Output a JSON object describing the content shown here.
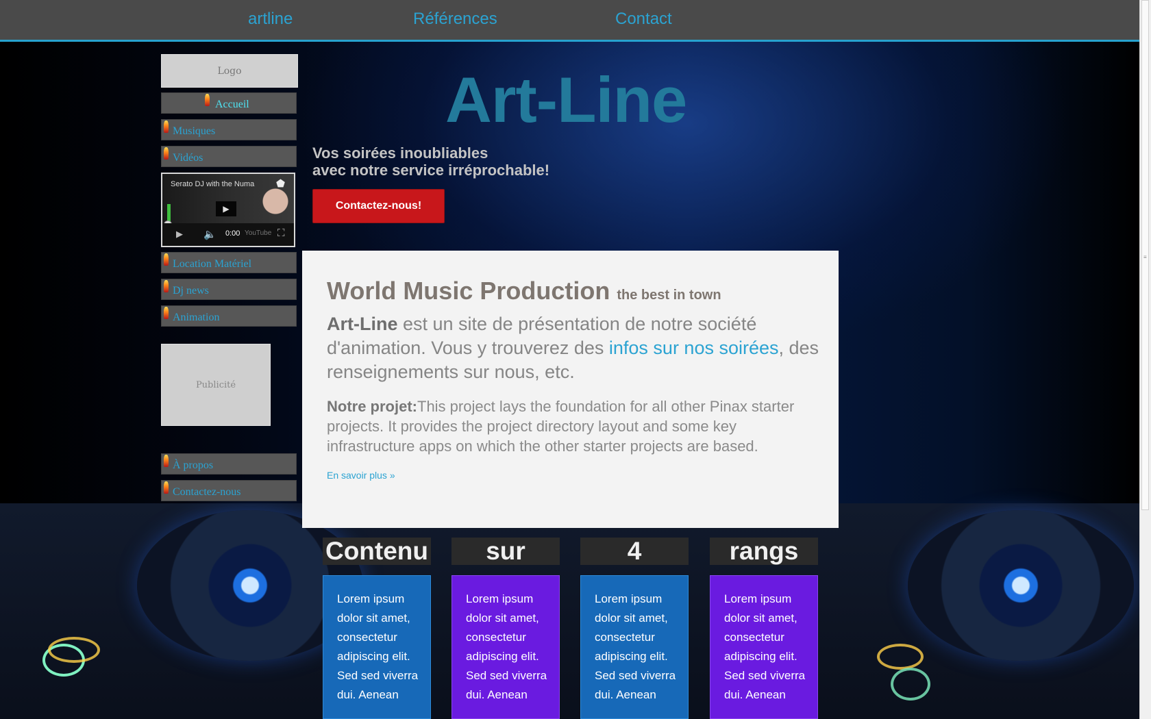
{
  "topnav": {
    "items": [
      "artline",
      "Références",
      "Contact"
    ]
  },
  "sidebar": {
    "logo": "Logo",
    "items_top": [
      "Accueil",
      "Musiques",
      "Vidéos"
    ],
    "video": {
      "title": "Serato DJ with the Numa",
      "time": "0:00",
      "brand": "YouTube"
    },
    "items_mid": [
      "Location Matériel",
      "Dj news",
      "Animation"
    ],
    "ad": "Publicité",
    "items_bottom": [
      "À propos",
      "Contactez-nous"
    ]
  },
  "hero": {
    "title": "Art-Line",
    "subtitle_line1": "Vos soirées inoubliables",
    "subtitle_line2": "avec notre service irréprochable!",
    "button": "Contactez-nous!"
  },
  "panel": {
    "heading": "World Music Production",
    "heading_small": "the best in town",
    "lead_bold": "Art-Line",
    "lead_text1": " est un site de présentation de notre société d'animation. Vous y trouverez des ",
    "lead_link": "infos sur nos soirées",
    "lead_text2": ", des renseignements sur nous, etc.",
    "project_label": "Notre projet:",
    "project_text": "This project lays the foundation for all other Pinax starter projects. It provides the project directory layout and some key infrastructure apps on which the other starter projects are based.",
    "more_link": "En savoir plus »"
  },
  "columns": [
    {
      "heading": "Contenu",
      "body": "Lorem ipsum dolor sit amet, consectetur adipiscing elit. Sed sed viverra dui. Aenean",
      "color": "#1769b8"
    },
    {
      "heading": "sur",
      "body": "Lorem ipsum dolor sit amet, consectetur adipiscing elit. Sed sed viverra dui. Aenean",
      "color": "#6a1be0"
    },
    {
      "heading": "4",
      "body": "Lorem ipsum dolor sit amet, consectetur adipiscing elit. Sed sed viverra dui. Aenean",
      "color": "#1769b8"
    },
    {
      "heading": "rangs",
      "body": "Lorem ipsum dolor sit amet, consectetur adipiscing elit. Sed sed viverra dui. Aenean",
      "color": "#6a1be0"
    }
  ],
  "colors": {
    "accent": "#2ba3d2",
    "button_red": "#c8171b",
    "topbar": "#4a4a4a"
  }
}
